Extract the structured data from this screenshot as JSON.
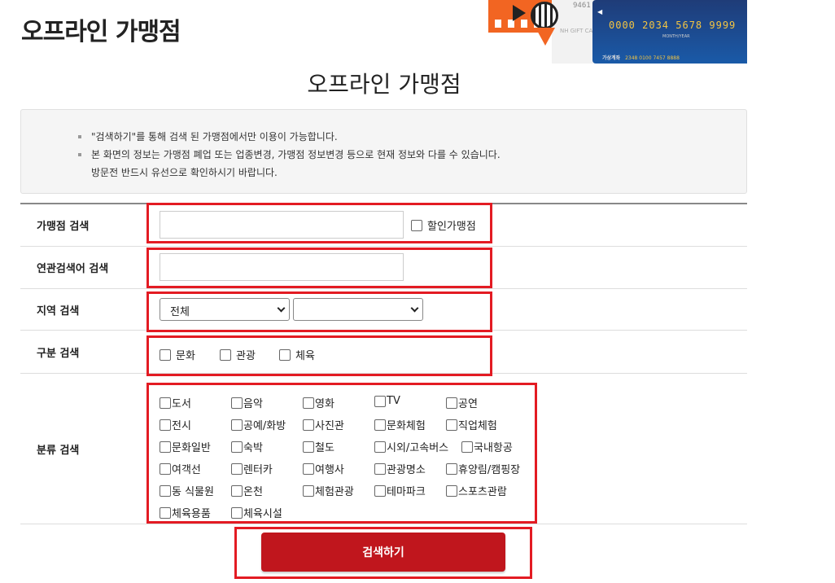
{
  "header": {
    "title": "오프라인 가맹점"
  },
  "banner": {
    "white_card_num": "9461",
    "white_card_label": "NH GIFT CARD",
    "card_number": "0000 2034 5678 9999",
    "card_sub": "MONTH/YEAR",
    "card_foot_label": "가상계좌",
    "card_foot_value": "2348 0100 7457 8888"
  },
  "main": {
    "title": "오프라인 가맹점"
  },
  "notice": {
    "items": [
      {
        "text": "\"검색하기\"를 통해 검색 된 가맹점에서만 이용이 가능합니다."
      },
      {
        "text": "본 화면의 정보는 가맹점 폐업 또는 업종변경, 가맹점 정보변경 등으로 현재 정보와 다를 수 있습니다.",
        "sub": "방문전 반드시 유선으로 확인하시기 바랍니다."
      }
    ]
  },
  "form": {
    "store_search": {
      "label": "가맹점 검색",
      "value": "",
      "discount_label": "할인가맹점",
      "discount_checked": false
    },
    "keyword_search": {
      "label": "연관검색어 검색",
      "value": ""
    },
    "region_search": {
      "label": "지역 검색",
      "region1_selected": "전체",
      "region2_selected": ""
    },
    "type_search": {
      "label": "구분 검색",
      "options": [
        "문화",
        "관광",
        "체육"
      ]
    },
    "category_search": {
      "label": "분류 검색",
      "options": [
        "도서",
        "음악",
        "영화",
        "TV",
        "공연",
        "전시",
        "공예/화방",
        "사진관",
        "문화체험",
        "직업체험",
        "문화일반",
        "숙박",
        "철도",
        "시외/고속버스",
        "국내항공",
        "여객선",
        "렌터카",
        "여행사",
        "관광명소",
        "휴양림/캠핑장",
        "동 식물원",
        "온천",
        "체험관광",
        "테마파크",
        "스포츠관람",
        "체육용품",
        "체육시설"
      ]
    }
  },
  "actions": {
    "search_label": "검색하기"
  },
  "colors": {
    "accent": "#c0161d",
    "highlight": "#e31b23",
    "banner_orange": "#f26522",
    "card_blue": "#1f3c78"
  }
}
